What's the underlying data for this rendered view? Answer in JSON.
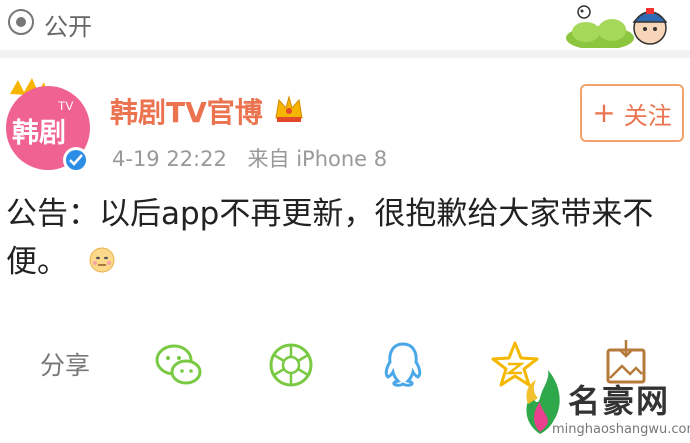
{
  "header": {
    "visibility_label": "公开",
    "icon": "eye-icon"
  },
  "post": {
    "avatar": {
      "label": "韩剧",
      "tv": "TV",
      "icon": "verified-badge-icon"
    },
    "username": "韩剧TV官博",
    "crown_icon": "vip-crown-icon",
    "timestamp": "4-19 22:22",
    "source": "来自 iPhone 8",
    "follow_label": "关注",
    "text": "公告：以后app不再更新，很抱歉给大家带来不便。",
    "emoji": "awkward-face-emoji"
  },
  "share": {
    "label": "分享",
    "targets": [
      "wechat-icon",
      "moments-icon",
      "qq-icon",
      "qzone-icon",
      "save-image-icon"
    ]
  },
  "watermark": {
    "title": "名豪网",
    "url": "minghaoshangwu.com"
  },
  "colors": {
    "accent": "#eb7350",
    "avatar_pink": "#f06292",
    "share_green": "#7ac943",
    "share_blue": "#4aa8e8",
    "share_yellow": "#f5b800"
  }
}
